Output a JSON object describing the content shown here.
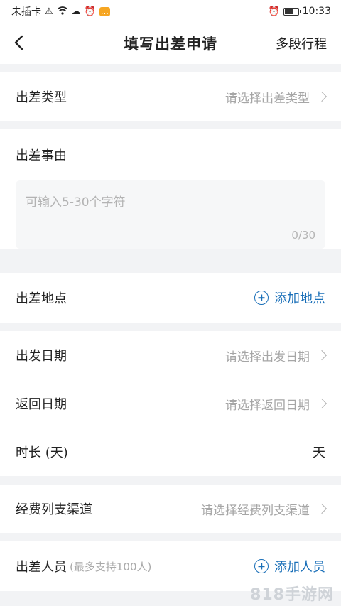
{
  "status_bar": {
    "carrier": "未插卡",
    "time": "10:33",
    "battery_level": 0.55
  },
  "nav": {
    "title": "填写出差申请",
    "right_action": "多段行程"
  },
  "trip_type": {
    "label": "出差类型",
    "placeholder": "请选择出差类型"
  },
  "reason": {
    "label": "出差事由",
    "placeholder": "可输入5-30个字符",
    "counter": "0/30"
  },
  "location": {
    "label": "出差地点",
    "add_label": "添加地点"
  },
  "depart_date": {
    "label": "出发日期",
    "placeholder": "请选择出发日期"
  },
  "return_date": {
    "label": "返回日期",
    "placeholder": "请选择返回日期"
  },
  "duration": {
    "label": "时长 (天)",
    "value": "天"
  },
  "expense": {
    "label": "经费列支渠道",
    "placeholder": "请选择经费列支渠道"
  },
  "personnel": {
    "label": "出差人员",
    "hint": "(最多支持100人)",
    "add_label": "添加人员"
  },
  "watermark": "818手游网"
}
